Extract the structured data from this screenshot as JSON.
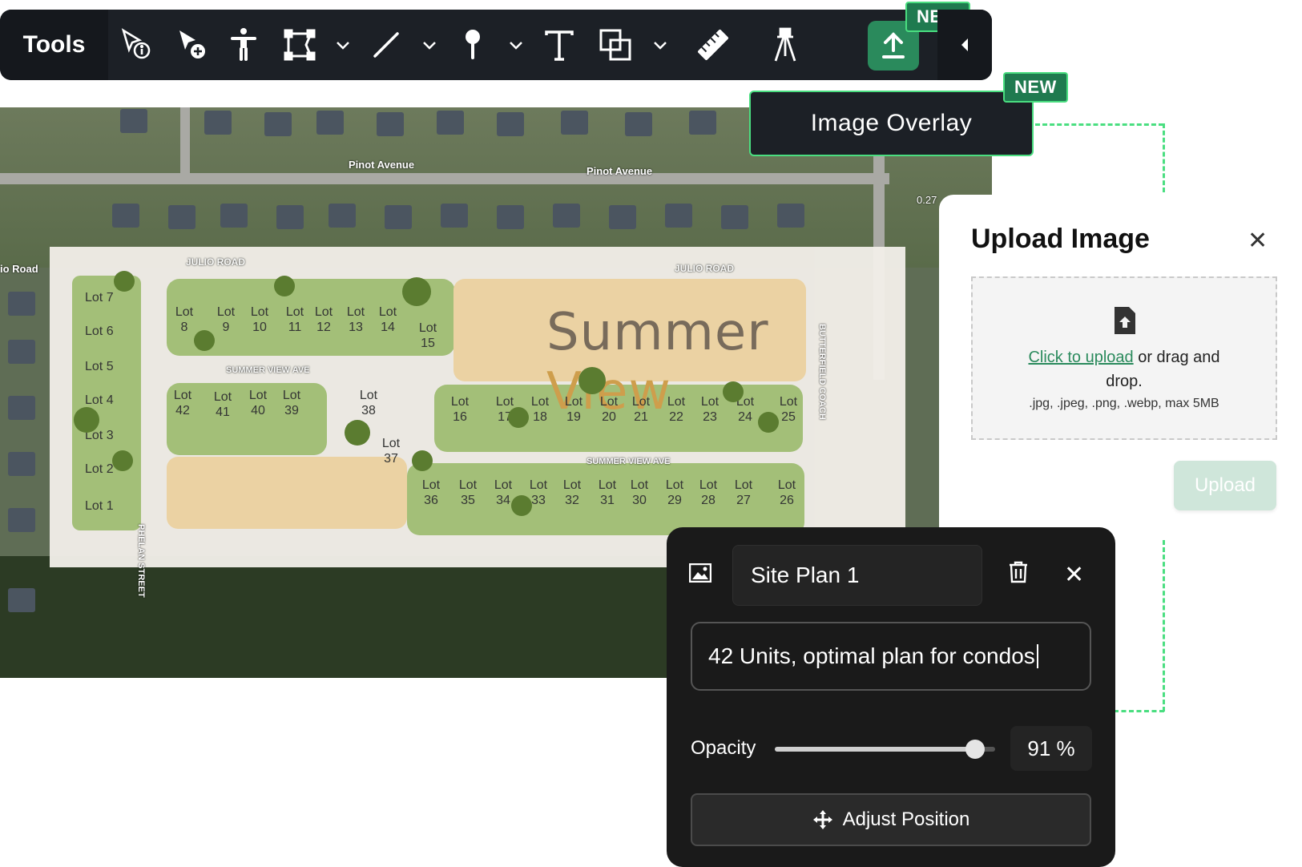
{
  "toolbar": {
    "title": "Tools",
    "tools": [
      {
        "name": "info-select-icon"
      },
      {
        "name": "add-select-icon"
      },
      {
        "name": "person-icon"
      },
      {
        "name": "polygon-icon"
      },
      {
        "name": "line-icon"
      },
      {
        "name": "pin-icon"
      },
      {
        "name": "text-icon"
      },
      {
        "name": "shape-overlap-icon"
      },
      {
        "name": "ruler-icon"
      },
      {
        "name": "tripod-icon"
      },
      {
        "name": "upload-icon"
      }
    ],
    "new_badge": "NEW"
  },
  "map": {
    "street_top_left": "Pinot Avenue",
    "street_top_right": "Pinot Avenue",
    "road_left": "io Road",
    "julio_left": "JULIO ROAD",
    "julio_right": "JULIO ROAD",
    "summer_ave_top": "SUMMER VIEW AVE",
    "summer_ave_bottom": "SUMMER VIEW AVE",
    "butterfield": "BUTTERFIELD COACH",
    "phelan": "PHELAN STREET",
    "measure": "0.27",
    "site_title_a": "Summer ",
    "site_title_b": "View",
    "lots": {
      "l7": "Lot 7",
      "l6": "Lot 6",
      "l5": "Lot 5",
      "l4": "Lot 4",
      "l3": "Lot 3",
      "l2": "Lot 2",
      "l1": "Lot 1",
      "l8": "Lot 8",
      "l9": "Lot 9",
      "l10": "Lot 10",
      "l11": "Lot 11",
      "l12": "Lot 12",
      "l13": "Lot 13",
      "l14": "Lot 14",
      "l15": "Lot 15",
      "l42": "Lot 42",
      "l41": "Lot 41",
      "l40": "Lot 40",
      "l39": "Lot 39",
      "l38": "Lot 38",
      "l37": "Lot 37",
      "l16": "Lot 16",
      "l17": "Lot 17",
      "l18": "Lot 18",
      "l19": "Lot 19",
      "l20": "Lot 20",
      "l21": "Lot 21",
      "l22": "Lot 22",
      "l23": "Lot 23",
      "l24": "Lot 24",
      "l25": "Lot 25",
      "l36": "Lot 36",
      "l35": "Lot 35",
      "l34": "Lot 34",
      "l33": "Lot 33",
      "l32": "Lot 32",
      "l31": "Lot 31",
      "l30": "Lot 30",
      "l29": "Lot 29",
      "l28": "Lot 28",
      "l27": "Lot 27",
      "l26": "Lot 26"
    }
  },
  "overlay_tooltip": {
    "label": "Image Overlay",
    "badge": "NEW"
  },
  "upload_panel": {
    "title": "Upload Image",
    "click_link": "Click to upload",
    "drag_text": " or drag and",
    "drop_text": "drop.",
    "formats": ".jpg, .jpeg, .png, .webp, max 5MB",
    "button": "Upload"
  },
  "plan_card": {
    "name": "Site Plan 1",
    "description": "42 Units, optimal plan for condos",
    "opacity_label": "Opacity",
    "opacity_value": 91,
    "opacity_display": "91 %",
    "adjust_label": "Adjust Position"
  },
  "colors": {
    "accent_green": "#2a8a5c",
    "badge_border": "#4ade80",
    "toolbar_bg": "#1c2026",
    "card_bg": "#1a1a1a"
  }
}
